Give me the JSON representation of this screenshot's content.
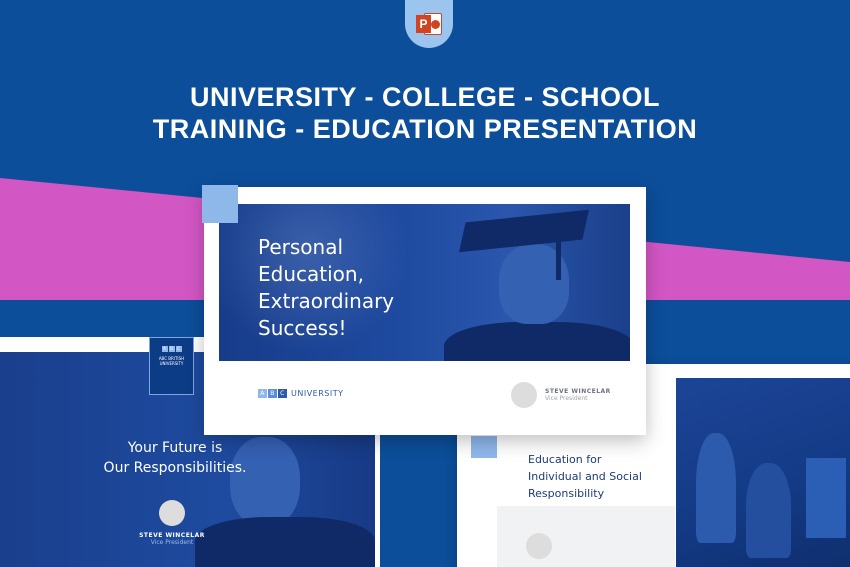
{
  "header": {
    "line1": "UNIVERSITY - COLLEGE - SCHOOL",
    "line2": "TRAINING - EDUCATION PRESENTATION"
  },
  "icons": {
    "app": "powerpoint-icon"
  },
  "main_slide": {
    "title_line1": "Personal",
    "title_line2": "Education,",
    "title_line3": "Extraordinary",
    "title_line4": "Success!",
    "brand_letters": [
      "A",
      "B",
      "C"
    ],
    "brand_text": "UNIVERSITY",
    "presenter_name": "STEVE WINCELAR",
    "presenter_role": "Vice President"
  },
  "left_slide": {
    "badge_line1": "ABC BRITISH",
    "badge_line2": "UNIVERSITY",
    "title_line1": "Your Future is",
    "title_line2": "Our Responsibilities.",
    "presenter_name": "STEVE WINCELAR",
    "presenter_role": "Vice President"
  },
  "right_slide": {
    "title_line1": "Education for",
    "title_line2": "Individual and Social",
    "title_line3": "Responsibility"
  },
  "colors": {
    "background_blue": "#0c4e9a",
    "band_pink": "#d356c5",
    "accent_light_blue": "#8eb7ea",
    "ppt_orange": "#d04423"
  }
}
